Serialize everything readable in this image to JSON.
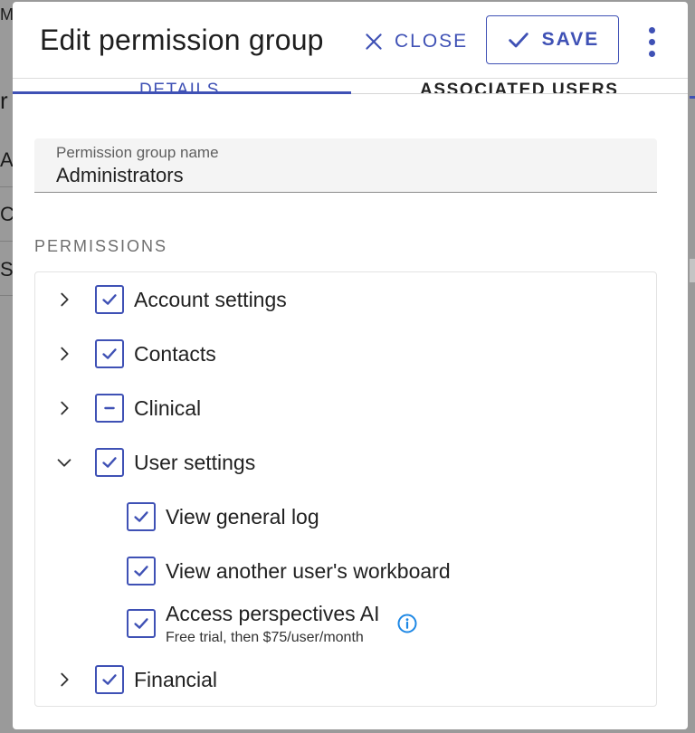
{
  "background": {
    "fragments": [
      "Ma",
      "r",
      "A",
      "C",
      "S"
    ]
  },
  "dialog": {
    "title": "Edit permission group",
    "close_label": "CLOSE",
    "save_label": "SAVE"
  },
  "tabs": [
    {
      "label": "DETAILS",
      "active": true
    },
    {
      "label": "ASSOCIATED USERS",
      "active": false
    }
  ],
  "name_field": {
    "label": "Permission group name",
    "value": "Administrators"
  },
  "permissions": {
    "heading": "PERMISSIONS",
    "items": [
      {
        "label": "Account settings",
        "expanded": false,
        "state": "checked"
      },
      {
        "label": "Contacts",
        "expanded": false,
        "state": "checked"
      },
      {
        "label": "Clinical",
        "expanded": false,
        "state": "indeterminate"
      },
      {
        "label": "User settings",
        "expanded": true,
        "state": "checked",
        "children": [
          {
            "label": "View general log",
            "state": "checked"
          },
          {
            "label": "View another user's workboard",
            "state": "checked"
          },
          {
            "label": "Access perspectives AI",
            "sublabel": "Free trial, then $75/user/month",
            "state": "checked",
            "icon": "info-icon"
          }
        ]
      },
      {
        "label": "Financial",
        "expanded": false,
        "state": "checked"
      }
    ]
  },
  "colors": {
    "accent": "#3f51b5",
    "info": "#1e88e5"
  }
}
